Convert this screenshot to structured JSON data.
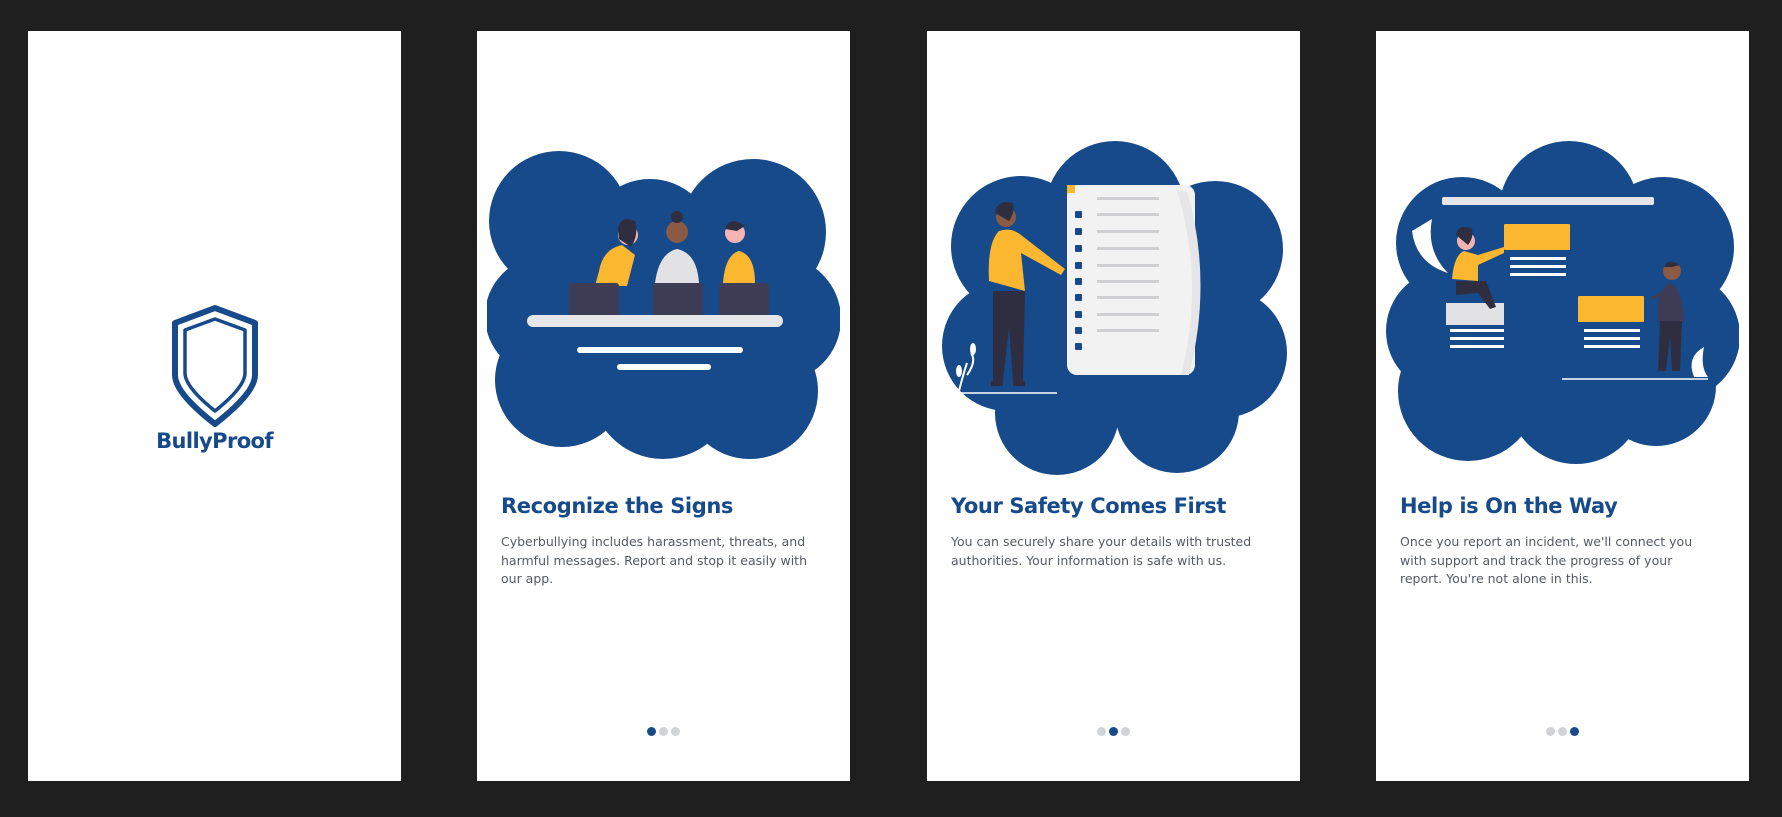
{
  "colors": {
    "background": "#1f1f1f",
    "brand_blue": "#164a8a",
    "accent_yellow": "#fbb730",
    "inactive_dot": "#d2d3d6",
    "body_text": "#555a63"
  },
  "splash": {
    "brand_name": "BullyProof",
    "logo_icon": "shield-icon"
  },
  "onboarding": [
    {
      "illustration": "people-at-laptops-illustration",
      "title": "Recognize the Signs",
      "description": "Cyberbullying includes harassment, threats, and harmful messages. Report and stop it easily with our app.",
      "active_page": 1,
      "page_count": 3
    },
    {
      "illustration": "person-with-checklist-illustration",
      "title": "Your Safety Comes First",
      "description": "You can securely share your details with trusted authorities. Your information is safe with us.",
      "active_page": 2,
      "page_count": 3
    },
    {
      "illustration": "support-team-illustration",
      "title": "Help is On the Way",
      "description": "Once you report an incident, we'll connect you with support and track the progress of your report. You're not alone in this.",
      "active_page": 3,
      "page_count": 3
    }
  ]
}
